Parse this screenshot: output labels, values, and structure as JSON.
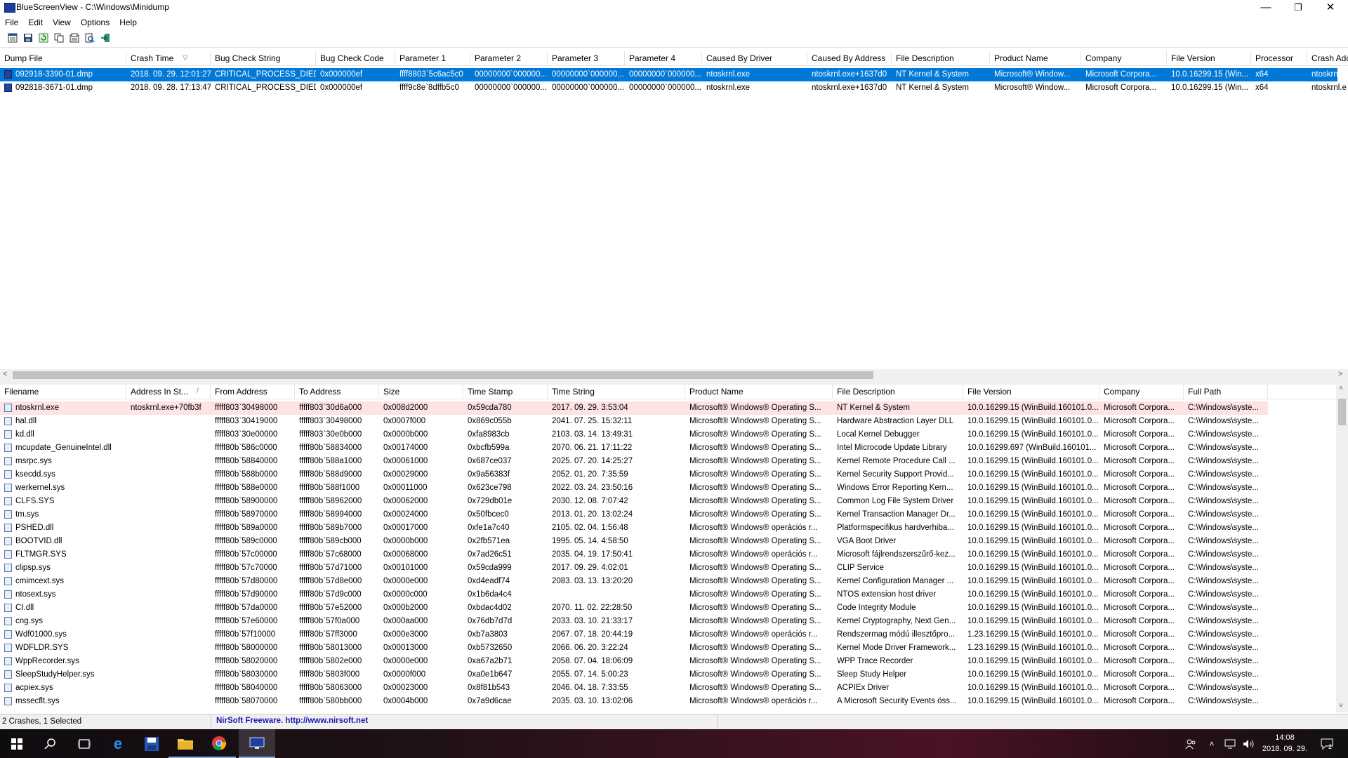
{
  "window": {
    "title": "BlueScreenView  -  C:\\Windows\\Minidump",
    "minimize": "—",
    "maximize": "❐",
    "close": "✕"
  },
  "menu": [
    "File",
    "Edit",
    "View",
    "Options",
    "Help"
  ],
  "toolbar": {
    "icons": [
      "properties-icon",
      "save-icon",
      "refresh-icon",
      "copy-icon",
      "html-report-icon",
      "find-icon",
      "exit-icon"
    ]
  },
  "dumps": {
    "columns": [
      "Dump File",
      "Crash Time",
      "Bug Check String",
      "Bug Check Code",
      "Parameter 1",
      "Parameter 2",
      "Parameter 3",
      "Parameter 4",
      "Caused By Driver",
      "Caused By Address",
      "File Description",
      "Product Name",
      "Company",
      "File Version",
      "Processor",
      "Crash Add"
    ],
    "sort_indicator": "▽",
    "rows": [
      [
        "092918-3390-01.dmp",
        "2018. 09. 29. 12:01:27",
        "CRITICAL_PROCESS_DIED",
        "0x000000ef",
        "ffff8803`5c6ac5c0",
        "00000000`000000...",
        "00000000`000000...",
        "00000000`000000...",
        "ntoskrnl.exe",
        "ntoskrnl.exe+1637d0",
        "NT Kernel & System",
        "Microsoft® Window...",
        "Microsoft Corpora...",
        "10.0.16299.15 (Win...",
        "x64",
        "ntoskrnl.e"
      ],
      [
        "092818-3671-01.dmp",
        "2018. 09. 28. 17:13:47",
        "CRITICAL_PROCESS_DIED",
        "0x000000ef",
        "ffff9c8e`8dffb5c0",
        "00000000`000000...",
        "00000000`000000...",
        "00000000`000000...",
        "ntoskrnl.exe",
        "ntoskrnl.exe+1637d0",
        "NT Kernel & System",
        "Microsoft® Window...",
        "Microsoft Corpora...",
        "10.0.16299.15 (Win...",
        "x64",
        "ntoskrnl.e"
      ]
    ]
  },
  "drivers": {
    "columns": [
      "Filename",
      "Address In St...",
      "From Address",
      "To Address",
      "Size",
      "Time Stamp",
      "Time String",
      "Product Name",
      "File Description",
      "File Version",
      "Company",
      "Full Path"
    ],
    "sort_indicator": "/",
    "rows": [
      [
        "ntoskrnl.exe",
        "ntoskrnl.exe+70fb3f",
        "fffff803`30498000",
        "fffff803`30d6a000",
        "0x008d2000",
        "0x59cda780",
        "2017. 09. 29. 3:53:04",
        "Microsoft® Windows® Operating S...",
        "NT Kernel & System",
        "10.0.16299.15 (WinBuild.160101.0...",
        "Microsoft Corpora...",
        "C:\\Windows\\syste..."
      ],
      [
        "hal.dll",
        "",
        "fffff803`30419000",
        "fffff803`30498000",
        "0x0007f000",
        "0x869c055b",
        "2041. 07. 25. 15:32:11",
        "Microsoft® Windows® Operating S...",
        "Hardware Abstraction Layer DLL",
        "10.0.16299.15 (WinBuild.160101.0...",
        "Microsoft Corpora...",
        "C:\\Windows\\syste..."
      ],
      [
        "kd.dll",
        "",
        "fffff803`30e00000",
        "fffff803`30e0b000",
        "0x0000b000",
        "0xfa8983cb",
        "2103. 03. 14. 13:49:31",
        "Microsoft® Windows® Operating S...",
        "Local Kernel Debugger",
        "10.0.16299.15 (WinBuild.160101.0...",
        "Microsoft Corpora...",
        "C:\\Windows\\syste..."
      ],
      [
        "mcupdate_GenuineIntel.dll",
        "",
        "fffff80b`586c0000",
        "fffff80b`58834000",
        "0x00174000",
        "0xbcfb599a",
        "2070. 06. 21. 17:11:22",
        "Microsoft® Windows® Operating S...",
        "Intel Microcode Update Library",
        "10.0.16299.697 (WinBuild.160101...",
        "Microsoft Corpora...",
        "C:\\Windows\\syste..."
      ],
      [
        "msrpc.sys",
        "",
        "fffff80b`58840000",
        "fffff80b`588a1000",
        "0x00061000",
        "0x687ce037",
        "2025. 07. 20. 14:25:27",
        "Microsoft® Windows® Operating S...",
        "Kernel Remote Procedure Call ...",
        "10.0.16299.15 (WinBuild.160101.0...",
        "Microsoft Corpora...",
        "C:\\Windows\\syste..."
      ],
      [
        "ksecdd.sys",
        "",
        "fffff80b`588b0000",
        "fffff80b`588d9000",
        "0x00029000",
        "0x9a56383f",
        "2052. 01. 20. 7:35:59",
        "Microsoft® Windows® Operating S...",
        "Kernel Security Support Provid...",
        "10.0.16299.15 (WinBuild.160101.0...",
        "Microsoft Corpora...",
        "C:\\Windows\\syste..."
      ],
      [
        "werkernel.sys",
        "",
        "fffff80b`588e0000",
        "fffff80b`588f1000",
        "0x00011000",
        "0x623ce798",
        "2022. 03. 24. 23:50:16",
        "Microsoft® Windows® Operating S...",
        "Windows Error Reporting Kern...",
        "10.0.16299.15 (WinBuild.160101.0...",
        "Microsoft Corpora...",
        "C:\\Windows\\syste..."
      ],
      [
        "CLFS.SYS",
        "",
        "fffff80b`58900000",
        "fffff80b`58962000",
        "0x00062000",
        "0x729db01e",
        "2030. 12. 08. 7:07:42",
        "Microsoft® Windows® Operating S...",
        "Common Log File System Driver",
        "10.0.16299.15 (WinBuild.160101.0...",
        "Microsoft Corpora...",
        "C:\\Windows\\syste..."
      ],
      [
        "tm.sys",
        "",
        "fffff80b`58970000",
        "fffff80b`58994000",
        "0x00024000",
        "0x50fbcec0",
        "2013. 01. 20. 13:02:24",
        "Microsoft® Windows® Operating S...",
        "Kernel Transaction Manager Dr...",
        "10.0.16299.15 (WinBuild.160101.0...",
        "Microsoft Corpora...",
        "C:\\Windows\\syste..."
      ],
      [
        "PSHED.dll",
        "",
        "fffff80b`589a0000",
        "fffff80b`589b7000",
        "0x00017000",
        "0xfe1a7c40",
        "2105. 02. 04. 1:56:48",
        "Microsoft® Windows® operációs r...",
        "Platformspecifikus hardverhiba...",
        "10.0.16299.15 (WinBuild.160101.0...",
        "Microsoft Corpora...",
        "C:\\Windows\\syste..."
      ],
      [
        "BOOTVID.dll",
        "",
        "fffff80b`589c0000",
        "fffff80b`589cb000",
        "0x0000b000",
        "0x2fb571ea",
        "1995. 05. 14. 4:58:50",
        "Microsoft® Windows® Operating S...",
        "VGA Boot Driver",
        "10.0.16299.15 (WinBuild.160101.0...",
        "Microsoft Corpora...",
        "C:\\Windows\\syste..."
      ],
      [
        "FLTMGR.SYS",
        "",
        "fffff80b`57c00000",
        "fffff80b`57c68000",
        "0x00068000",
        "0x7ad26c51",
        "2035. 04. 19. 17:50:41",
        "Microsoft® Windows® operációs r...",
        "Microsoft fájlrendszerszűrő-kez...",
        "10.0.16299.15 (WinBuild.160101.0...",
        "Microsoft Corpora...",
        "C:\\Windows\\syste..."
      ],
      [
        "clipsp.sys",
        "",
        "fffff80b`57c70000",
        "fffff80b`57d71000",
        "0x00101000",
        "0x59cda999",
        "2017. 09. 29. 4:02:01",
        "Microsoft® Windows® Operating S...",
        "CLIP Service",
        "10.0.16299.15 (WinBuild.160101.0...",
        "Microsoft Corpora...",
        "C:\\Windows\\syste..."
      ],
      [
        "cmimcext.sys",
        "",
        "fffff80b`57d80000",
        "fffff80b`57d8e000",
        "0x0000e000",
        "0xd4eadf74",
        "2083. 03. 13. 13:20:20",
        "Microsoft® Windows® Operating S...",
        "Kernel Configuration Manager ...",
        "10.0.16299.15 (WinBuild.160101.0...",
        "Microsoft Corpora...",
        "C:\\Windows\\syste..."
      ],
      [
        "ntosext.sys",
        "",
        "fffff80b`57d90000",
        "fffff80b`57d9c000",
        "0x0000c000",
        "0x1b6da4c4",
        "",
        "Microsoft® Windows® Operating S...",
        "NTOS extension host driver",
        "10.0.16299.15 (WinBuild.160101.0...",
        "Microsoft Corpora...",
        "C:\\Windows\\syste..."
      ],
      [
        "CI.dll",
        "",
        "fffff80b`57da0000",
        "fffff80b`57e52000",
        "0x000b2000",
        "0xbdac4d02",
        "2070. 11. 02. 22:28:50",
        "Microsoft® Windows® Operating S...",
        "Code Integrity Module",
        "10.0.16299.15 (WinBuild.160101.0...",
        "Microsoft Corpora...",
        "C:\\Windows\\syste..."
      ],
      [
        "cng.sys",
        "",
        "fffff80b`57e60000",
        "fffff80b`57f0a000",
        "0x000aa000",
        "0x76db7d7d",
        "2033. 03. 10. 21:33:17",
        "Microsoft® Windows® Operating S...",
        "Kernel Cryptography, Next Gen...",
        "10.0.16299.15 (WinBuild.160101.0...",
        "Microsoft Corpora...",
        "C:\\Windows\\syste..."
      ],
      [
        "Wdf01000.sys",
        "",
        "fffff80b`57f10000",
        "fffff80b`57ff3000",
        "0x000e3000",
        "0xb7a3803",
        "2067. 07. 18. 20:44:19",
        "Microsoft® Windows® operációs r...",
        "Rendszermag módú illesztőpro...",
        "1.23.16299.15 (WinBuild.160101.0...",
        "Microsoft Corpora...",
        "C:\\Windows\\syste..."
      ],
      [
        "WDFLDR.SYS",
        "",
        "fffff80b`58000000",
        "fffff80b`58013000",
        "0x00013000",
        "0xb5732650",
        "2066. 06. 20. 3:22:24",
        "Microsoft® Windows® Operating S...",
        "Kernel Mode Driver Framework...",
        "1.23.16299.15 (WinBuild.160101.0...",
        "Microsoft Corpora...",
        "C:\\Windows\\syste..."
      ],
      [
        "WppRecorder.sys",
        "",
        "fffff80b`58020000",
        "fffff80b`5802e000",
        "0x0000e000",
        "0xa67a2b71",
        "2058. 07. 04. 18:06:09",
        "Microsoft® Windows® Operating S...",
        "WPP Trace Recorder",
        "10.0.16299.15 (WinBuild.160101.0...",
        "Microsoft Corpora...",
        "C:\\Windows\\syste..."
      ],
      [
        "SleepStudyHelper.sys",
        "",
        "fffff80b`58030000",
        "fffff80b`5803f000",
        "0x0000f000",
        "0xa0e1b647",
        "2055. 07. 14. 5:00:23",
        "Microsoft® Windows® Operating S...",
        "Sleep Study Helper",
        "10.0.16299.15 (WinBuild.160101.0...",
        "Microsoft Corpora...",
        "C:\\Windows\\syste..."
      ],
      [
        "acpiex.sys",
        "",
        "fffff80b`58040000",
        "fffff80b`58063000",
        "0x00023000",
        "0x8f81b543",
        "2046. 04. 18. 7:33:55",
        "Microsoft® Windows® Operating S...",
        "ACPIEx Driver",
        "10.0.16299.15 (WinBuild.160101.0...",
        "Microsoft Corpora...",
        "C:\\Windows\\syste..."
      ],
      [
        "mssecflt.sys",
        "",
        "fffff80b`58070000",
        "fffff80b`580bb000",
        "0x0004b000",
        "0x7a9d6cae",
        "2035. 03. 10. 13:02:06",
        "Microsoft® Windows® operációs r...",
        "A Microsoft Security Events öss...",
        "10.0.16299.15 (WinBuild.160101.0...",
        "Microsoft Corpora...",
        "C:\\Windows\\syste..."
      ]
    ]
  },
  "status": {
    "count": "2 Crashes, 1 Selected",
    "freeware": "NirSoft Freeware.  http://www.nirsoft.net"
  },
  "taskbar": {
    "icons": [
      "start-icon",
      "search-icon",
      "task-view-icon",
      "edge-icon",
      "floppy-icon",
      "file-explorer-icon",
      "chrome-icon",
      "bluescreenview-icon"
    ],
    "clock_time": "14:08",
    "clock_date": "2018. 09. 29.",
    "notification_count": "2"
  }
}
